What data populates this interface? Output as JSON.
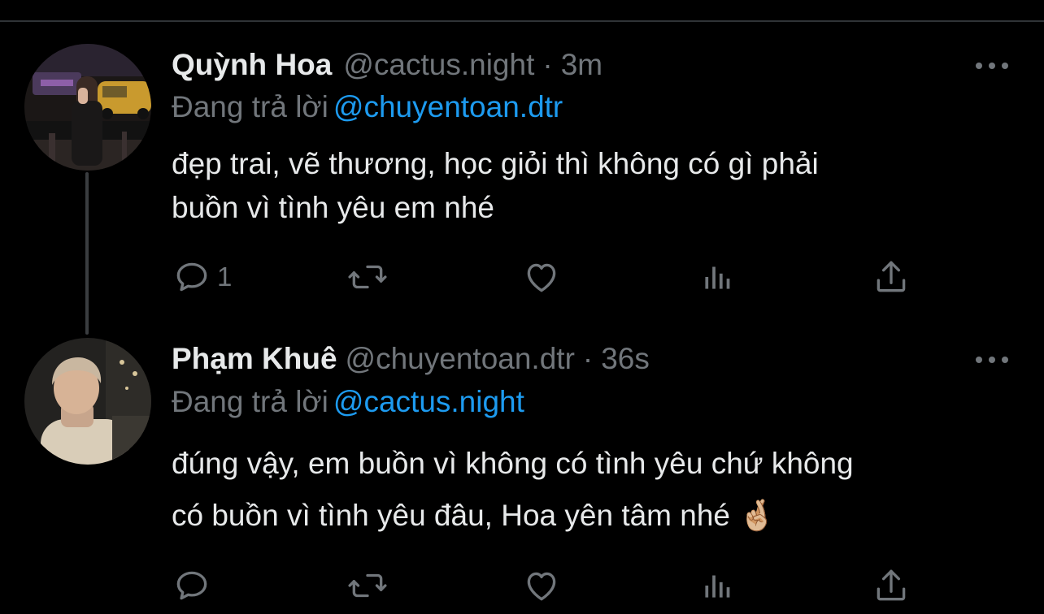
{
  "tweets": [
    {
      "display_name": "Quỳnh Hoa",
      "handle": "@cactus.night",
      "separator": "·",
      "time": "3m",
      "reply_prefix": "Đang trả lời",
      "reply_to": "@chuyentoan.dtr",
      "text_lines": [
        "đẹp trai, vẽ thương, học giỏi thì không có gì phải",
        "buồn vì tình yêu em nhé"
      ],
      "reply_count": "1",
      "avatar": "photo-woman-night-street"
    },
    {
      "display_name": "Phạm Khuê",
      "handle": "@chuyentoan.dtr",
      "separator": "·",
      "time": "36s",
      "reply_prefix": "Đang trả lời",
      "reply_to": "@cactus.night",
      "text_lines": [
        "đúng vậy, em buồn vì không có tình yêu chứ không",
        "có buồn vì tình yêu đâu, Hoa yên tâm nhé 🤞🏼"
      ],
      "reply_count": "",
      "avatar": "photo-man-light-hair"
    }
  ],
  "icons": {
    "reply": "speech-bubble-icon",
    "retweet": "retweet-icon",
    "like": "heart-icon",
    "views": "bar-chart-icon",
    "share": "share-upload-icon",
    "more": "more-dots-icon"
  },
  "colors": {
    "background": "#000000",
    "text": "#e7e9ea",
    "secondary": "#71767b",
    "link": "#1d9bf0",
    "divider": "#2f3336"
  }
}
